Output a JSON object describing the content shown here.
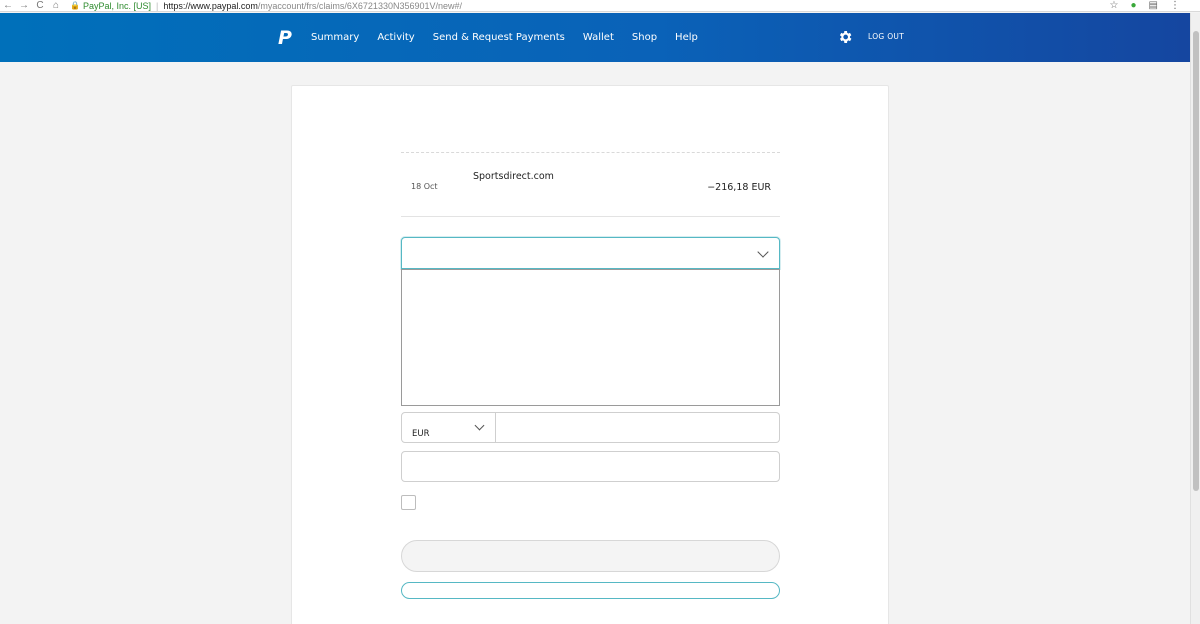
{
  "browser": {
    "nav_icons": [
      "←",
      "→",
      "C",
      "⌂"
    ],
    "site_name": "PayPal, Inc. [US]",
    "url_host": "https://www.paypal.com",
    "url_path": "/myaccount/frs/claims/6X6721330N356901V/new#/"
  },
  "header": {
    "nav": [
      "Summary",
      "Activity",
      "Send & Request Payments",
      "Wallet",
      "Shop",
      "Help"
    ],
    "logout_label": "LOG OUT"
  },
  "transaction": {
    "date": "18 Oct",
    "merchant": "Sportsdirect.com",
    "amount": "−216,18 EUR"
  },
  "form": {
    "currency": "EUR"
  },
  "colors": {
    "header_start": "#0070ba",
    "header_end": "#1546a0",
    "focus_accent": "#56b8c4"
  }
}
